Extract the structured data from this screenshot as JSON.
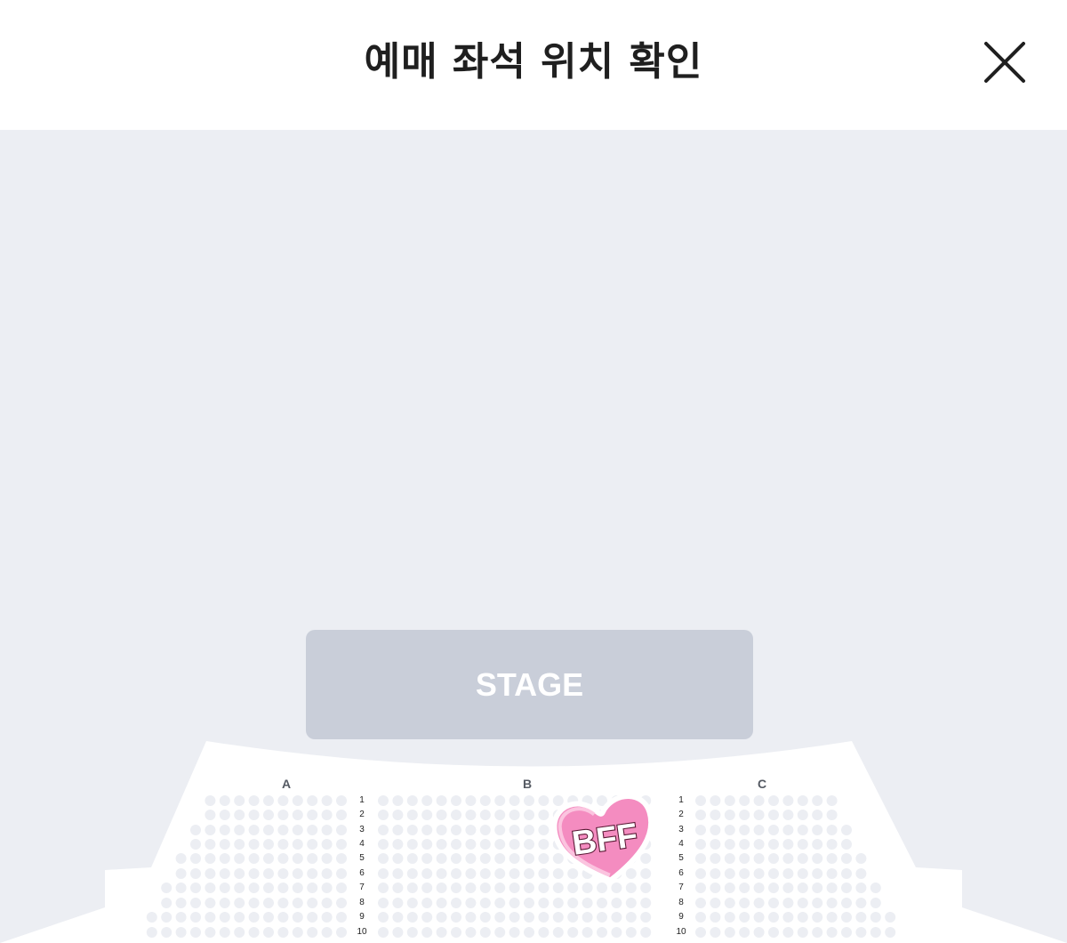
{
  "header": {
    "title": "예매 좌석 위치 확인",
    "close_icon": "close-icon"
  },
  "stage": {
    "label": "STAGE"
  },
  "sections": [
    {
      "label": "A"
    },
    {
      "label": "B"
    },
    {
      "label": "C"
    }
  ],
  "rows": [
    "1",
    "2",
    "3",
    "4",
    "5",
    "6",
    "7",
    "8",
    "9",
    "10"
  ],
  "sticker": {
    "text": "BFF",
    "icon": "heart-sticker-icon"
  },
  "colors": {
    "background": "#eceef3",
    "stage": "#c9ced9",
    "seat": "#eceef3",
    "seating_area": "#ffffff",
    "sticker_pink": "#f48cc0"
  }
}
